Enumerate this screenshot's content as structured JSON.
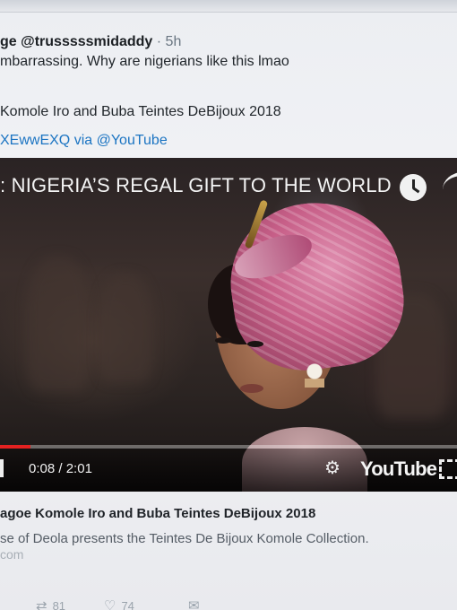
{
  "tweet": {
    "user_handle": "ge @trusssssmidaddy",
    "time": "· 5h",
    "text": "mbarrassing. Why are nigerians like this lmao",
    "line1": "Komole Iro and Buba Teintes DeBijoux 2018",
    "line2_prefix": "XEwwEXQ via ",
    "line2_link": "@YouTube"
  },
  "video": {
    "title": ": NIGERIA’S REGAL GIFT TO THE WORLD",
    "time_current": "0:08",
    "time_separator": " / ",
    "time_total": "2:01",
    "progress_fraction": 0.066,
    "platform": "YouTube",
    "icons": [
      "clock-icon",
      "share-icon",
      "volume-icon",
      "gear-icon",
      "fullscreen-icon"
    ]
  },
  "card": {
    "title": "agoe Komole Iro and Buba Teintes DeBijoux 2018",
    "description": "se of Deola presents the Teintes De Bijoux Komole Collection.",
    "domain": "com"
  },
  "actions": {
    "retweet_count": "81",
    "like_count": "74"
  },
  "colors": {
    "link": "#1b74c2",
    "progress": "#e42121"
  }
}
